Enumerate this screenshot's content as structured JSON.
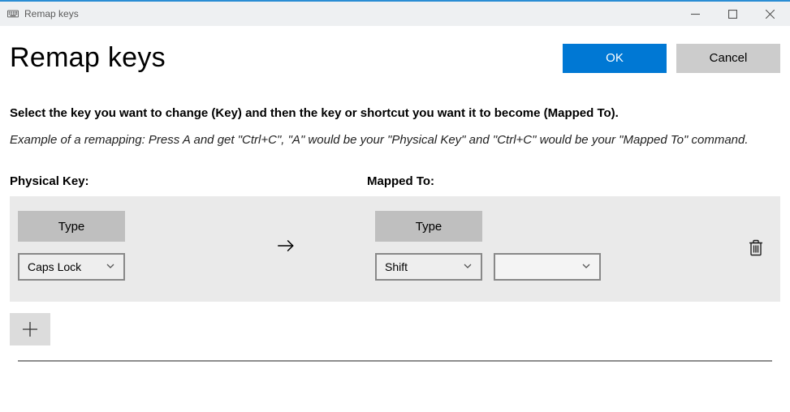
{
  "window": {
    "title": "Remap keys"
  },
  "header": {
    "title": "Remap keys",
    "ok_label": "OK",
    "cancel_label": "Cancel"
  },
  "instructions": "Select the key you want to change (Key) and then the key or shortcut you want it to become (Mapped To).",
  "example": "Example of a remapping: Press A and get \"Ctrl+C\", \"A\" would be your \"Physical Key\" and \"Ctrl+C\" would be your \"Mapped To\" command.",
  "columns": {
    "physical": "Physical Key:",
    "mapped": "Mapped To:"
  },
  "row": {
    "type_label": "Type",
    "physical_key": "Caps Lock",
    "mapped_key_1": "Shift",
    "mapped_key_2": ""
  }
}
